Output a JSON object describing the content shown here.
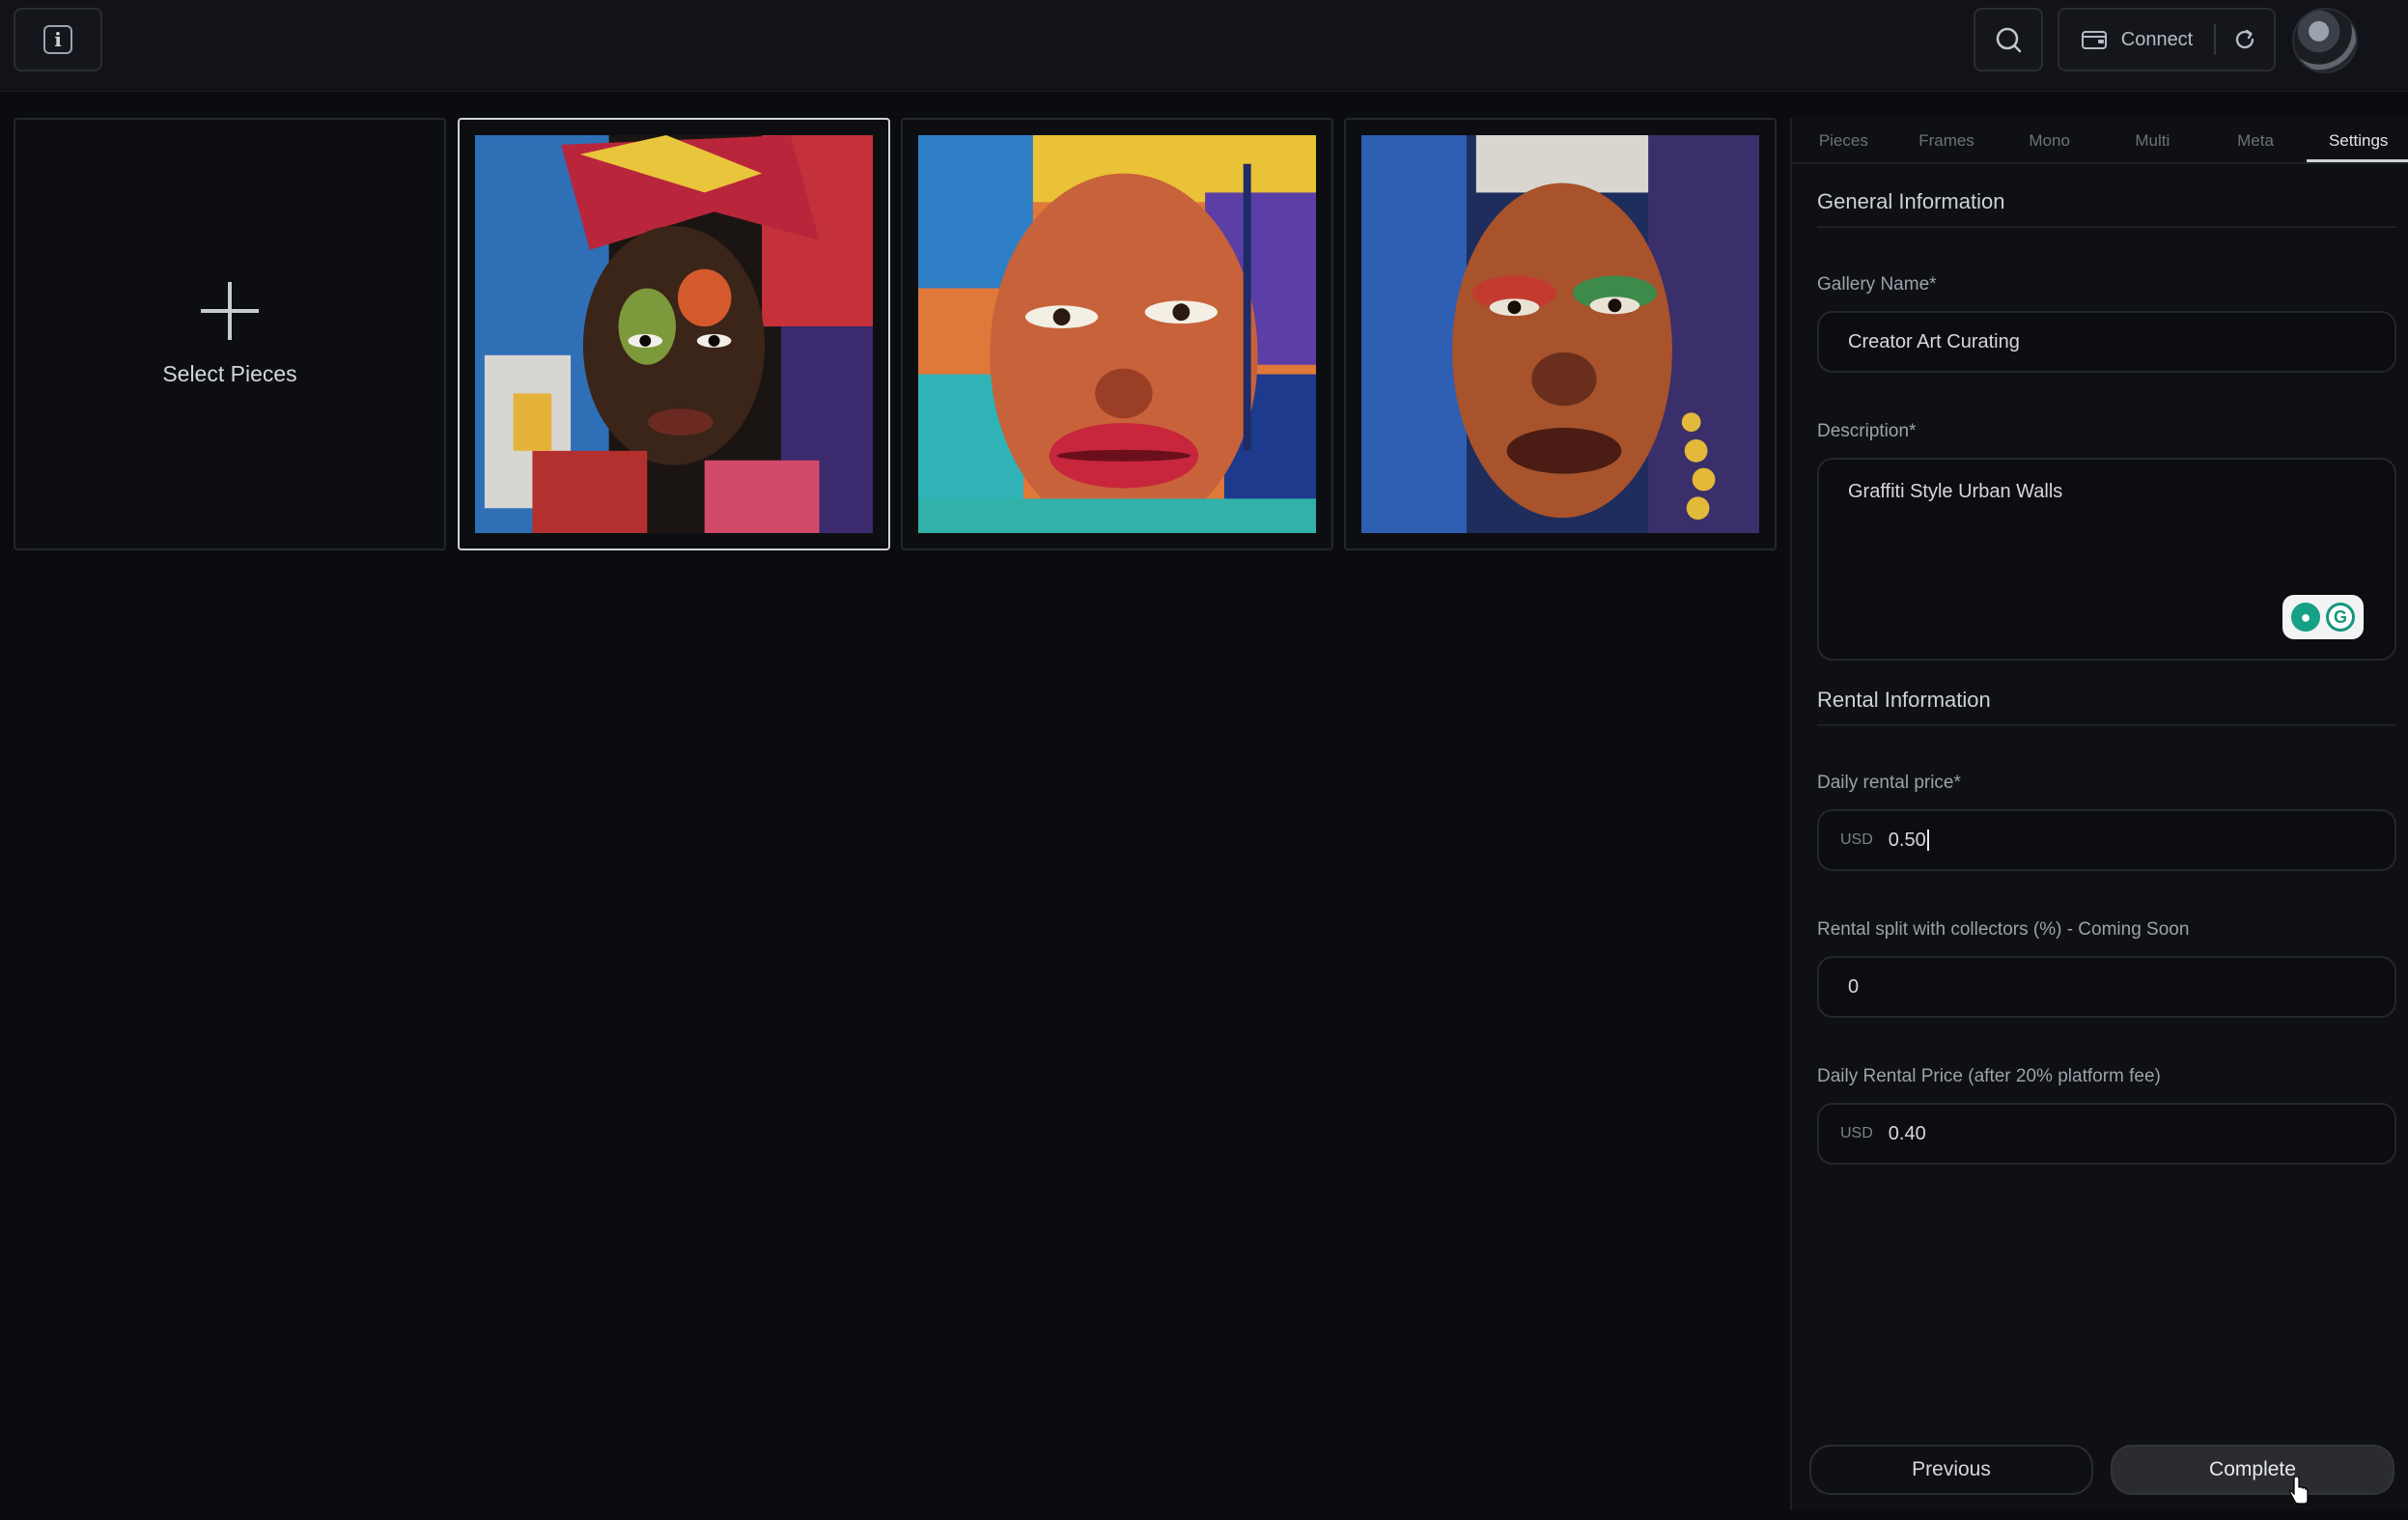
{
  "header": {
    "info_icon": "info-icon",
    "search_icon": "search-icon",
    "connect_label": "Connect",
    "wallet_icon": "wallet-icon",
    "refresh_icon": "refresh-icon",
    "avatar": "user-avatar"
  },
  "gallery": {
    "select_label": "Select Pieces",
    "add_icon": "plus-icon",
    "pieces": [
      {
        "name": "artwork-1",
        "selected": true
      },
      {
        "name": "artwork-2",
        "selected": false
      },
      {
        "name": "artwork-3",
        "selected": false
      }
    ]
  },
  "panel": {
    "tabs": [
      {
        "label": "Pieces",
        "active": false
      },
      {
        "label": "Frames",
        "active": false
      },
      {
        "label": "Mono",
        "active": false
      },
      {
        "label": "Multi",
        "active": false
      },
      {
        "label": "Meta",
        "active": false
      },
      {
        "label": "Settings",
        "active": true
      }
    ],
    "general": {
      "title": "General Information",
      "gallery_name_label": "Gallery Name*",
      "gallery_name_value": "Creator Art Curating",
      "description_label": "Description*",
      "description_value": "Graffiti Style Urban Walls"
    },
    "rental": {
      "title": "Rental Information",
      "daily_price_label": "Daily rental price*",
      "daily_price_currency": "USD",
      "daily_price_value": "0.50",
      "split_label": "Rental split with collectors (%) - Coming Soon",
      "split_value": "0",
      "after_fee_label": "Daily Rental Price (after 20% platform fee)",
      "after_fee_currency": "USD",
      "after_fee_value": "0.40"
    },
    "buttons": {
      "previous": "Previous",
      "complete": "Complete"
    }
  },
  "colors": {
    "background": "#0b0c0f",
    "panel": "#0f1014",
    "accent": "#cfd2d8"
  }
}
